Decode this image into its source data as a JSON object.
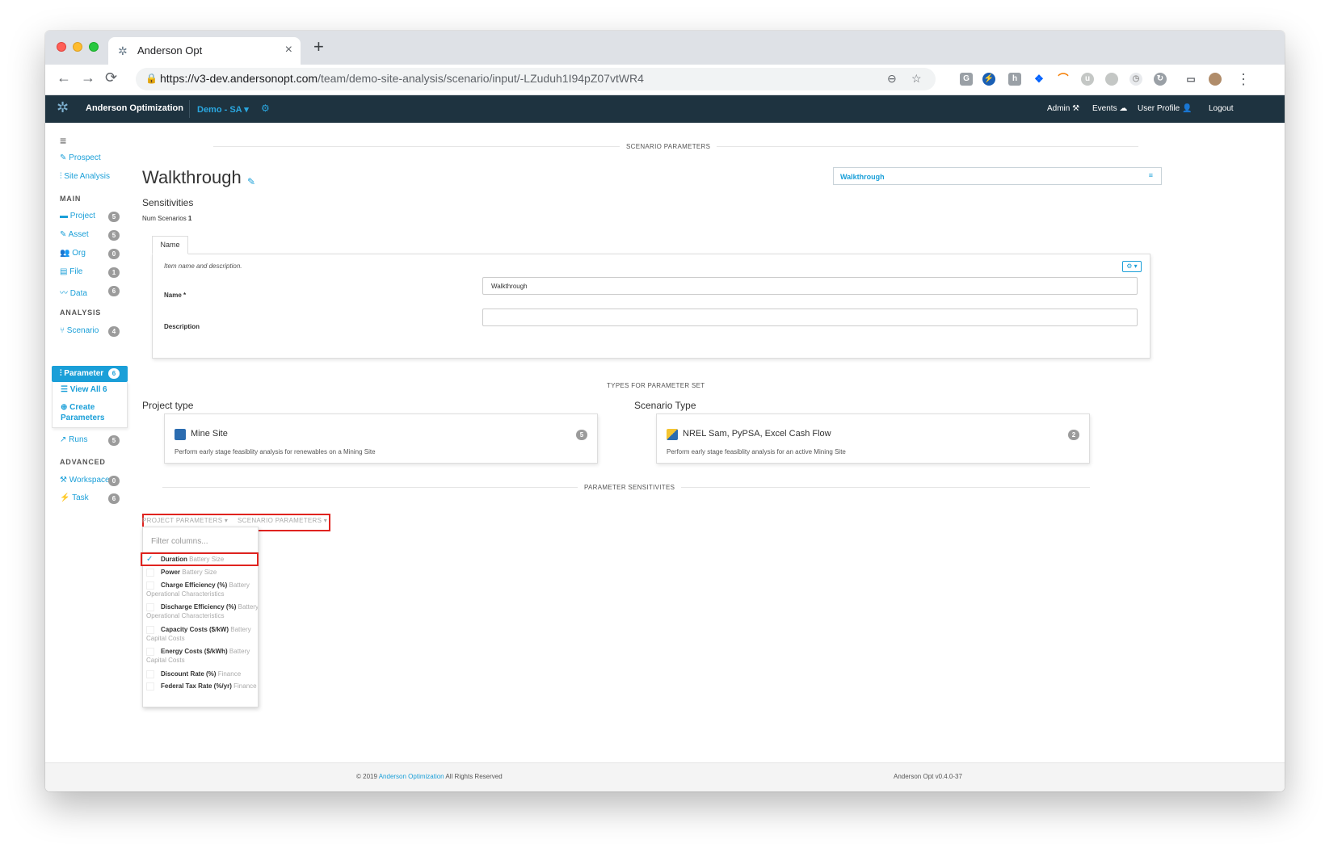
{
  "browser": {
    "tab_title": "Anderson Opt",
    "tab_close": "×",
    "new_tab": "+",
    "url_host": "https://v3-dev.andersonopt.com",
    "url_path": "/team/demo-site-analysis/scenario/input/-LZuduh1I94pZ07vtWR4",
    "nav": {
      "back": "←",
      "forward": "→",
      "reload": "⟳",
      "lock": "🔒",
      "zoom": "⊖",
      "star": "☆",
      "menu": "⋮"
    }
  },
  "app_nav": {
    "brand": "Anderson Optimization",
    "org": "Demo - SA ▾",
    "gear": "⚙",
    "admin": "Admin ⚒",
    "events": "Events ☁",
    "user_profile": "User Profile 👤",
    "logout": "Logout"
  },
  "sidebar": {
    "menu": "≡",
    "top_links": [
      "Prospect",
      "Site Analysis"
    ],
    "main_title": "MAIN",
    "main_items": [
      {
        "label": "Project",
        "count": "5"
      },
      {
        "label": "Asset",
        "count": "5"
      },
      {
        "label": "Org",
        "count": "0"
      },
      {
        "label": "File",
        "count": "1"
      },
      {
        "label": "Data",
        "count": "6"
      }
    ],
    "analysis_title": "ANALYSIS",
    "scenario": {
      "label": "Scenario",
      "count": "4"
    },
    "parameter": {
      "label": "Parameter",
      "count": "6"
    },
    "view_all": {
      "label": "View All",
      "count": "6"
    },
    "create_params": [
      "Create",
      "Parameters"
    ],
    "runs": {
      "label": "Runs",
      "count": "5"
    },
    "advanced_title": "ADVANCED",
    "advanced_items": [
      {
        "label": "Workspace",
        "count": "0"
      },
      {
        "label": "Task",
        "count": "6"
      }
    ]
  },
  "main": {
    "scenario_params_title": "SCENARIO PARAMETERS",
    "title": "Walkthrough",
    "edit_icon": "✎",
    "subtitle": "Sensitivities",
    "num_scenarios_label": "Num Scenarios",
    "num_scenarios_value": "1",
    "picker_value": "Walkthrough",
    "picker_icon": "≡",
    "form": {
      "tab": "Name",
      "description": "Item name and description.",
      "gear": "⚙ ▾",
      "name_label": "Name *",
      "name_value": "Walkthrough",
      "description_label": "Description",
      "description_value": ""
    },
    "types_title": "TYPES FOR PARAMETER SET",
    "project_type": {
      "heading": "Project type",
      "name": "Mine Site",
      "desc": "Perform early stage feasiblity analysis for renewables on a Mining Site",
      "count": "5"
    },
    "scenario_type": {
      "heading": "Scenario Type",
      "name": "NREL Sam, PyPSA, Excel Cash Flow",
      "desc": "Perform early stage feasiblity analysis for an active Mining Site",
      "count": "2"
    },
    "sensitivities_title": "PARAMETER SENSITIVITES",
    "param_tabs": [
      "PROJECT PARAMETERS ▾",
      "SCENARIO PARAMETERS ▾"
    ],
    "filter_placeholder": "Filter columns...",
    "columns": [
      {
        "name": "Duration",
        "group": "Battery Size",
        "checked": true
      },
      {
        "name": "Power",
        "group": "Battery Size",
        "checked": false
      },
      {
        "name": "Charge Efficiency (%)",
        "group": "Battery Operational Characteristics",
        "checked": false
      },
      {
        "name": "Discharge Efficiency (%)",
        "group": "Battery Operational Characteristics",
        "checked": false
      },
      {
        "name": "Capacity Costs ($/kW)",
        "group": "Battery Capital Costs",
        "checked": false
      },
      {
        "name": "Energy Costs ($/kWh)",
        "group": "Battery Capital Costs",
        "checked": false
      },
      {
        "name": "Discount Rate (%)",
        "group": "Finance",
        "checked": false
      },
      {
        "name": "Federal Tax Rate (%/yr)",
        "group": "Finance",
        "checked": false
      }
    ]
  },
  "footer": {
    "copyright_prefix": "© 2019",
    "company": "Anderson Optimization",
    "rights": "All Rights Reserved",
    "version": "Anderson Opt v0.4.0-37"
  },
  "colors": {
    "navbar": "#1e3340",
    "accent": "#1a9fd8",
    "highlight": "#e0231f"
  }
}
